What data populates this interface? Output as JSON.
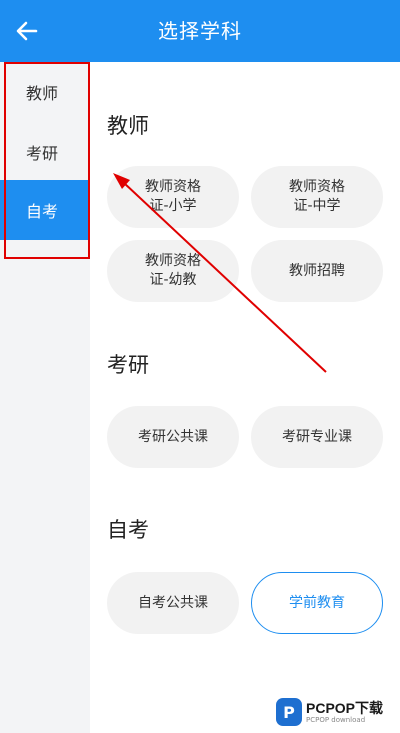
{
  "header": {
    "title": "选择学科"
  },
  "sidebar": {
    "items": [
      {
        "label": "教师"
      },
      {
        "label": "考研"
      },
      {
        "label": "自考"
      }
    ],
    "active": "自考"
  },
  "sections": [
    {
      "title": "教师",
      "chips": [
        {
          "label": "教师资格\n证-小学"
        },
        {
          "label": "教师资格\n证-中学"
        },
        {
          "label": "教师资格\n证-幼教"
        },
        {
          "label": "教师招聘"
        }
      ]
    },
    {
      "title": "考研",
      "chips": [
        {
          "label": "考研公共课"
        },
        {
          "label": "考研专业课"
        }
      ]
    },
    {
      "title": "自考",
      "chips": [
        {
          "label": "自考公共课"
        },
        {
          "label": "学前教育"
        }
      ]
    }
  ],
  "selected_chip": "学前教育",
  "watermark": {
    "logo_letter": "P",
    "main": "PCPOP下载",
    "sub": "PCPOP download"
  },
  "colors": {
    "accent": "#1e8ef0",
    "annotation": "#e00000"
  }
}
